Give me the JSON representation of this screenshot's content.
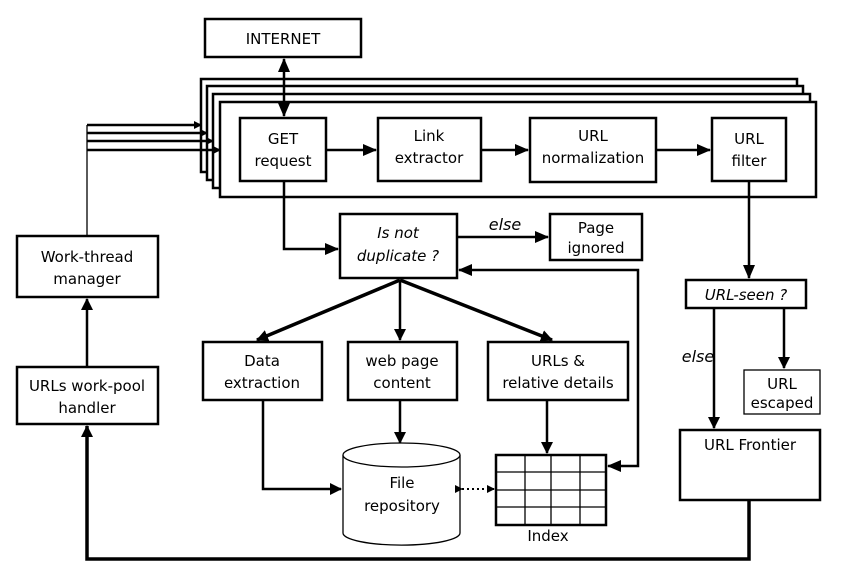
{
  "nodes": {
    "internet": "INTERNET",
    "get_request": [
      "GET",
      "request"
    ],
    "link_extractor": [
      "Link",
      "extractor"
    ],
    "url_normalization": [
      "URL",
      "normalization"
    ],
    "url_filter": [
      "URL",
      "filter"
    ],
    "is_not_duplicate": [
      "Is not",
      "duplicate ?"
    ],
    "page_ignored": [
      "Page",
      "ignored"
    ],
    "work_thread_manager": [
      "Work-thread",
      "manager"
    ],
    "urls_work_pool_handler": [
      "URLs work-pool",
      "handler"
    ],
    "data_extraction": [
      "Data",
      "extraction"
    ],
    "web_page_content": [
      "web page",
      "content"
    ],
    "urls_relative_details": [
      "URLs &",
      "relative details"
    ],
    "file_repository": [
      "File",
      "repository"
    ],
    "index": "Index",
    "url_seen": "URL-seen ?",
    "url_escaped": [
      "URL",
      "escaped"
    ],
    "url_frontier": "URL Frontier"
  },
  "labels": {
    "else_duplicate": "else",
    "else_seen": "else"
  }
}
